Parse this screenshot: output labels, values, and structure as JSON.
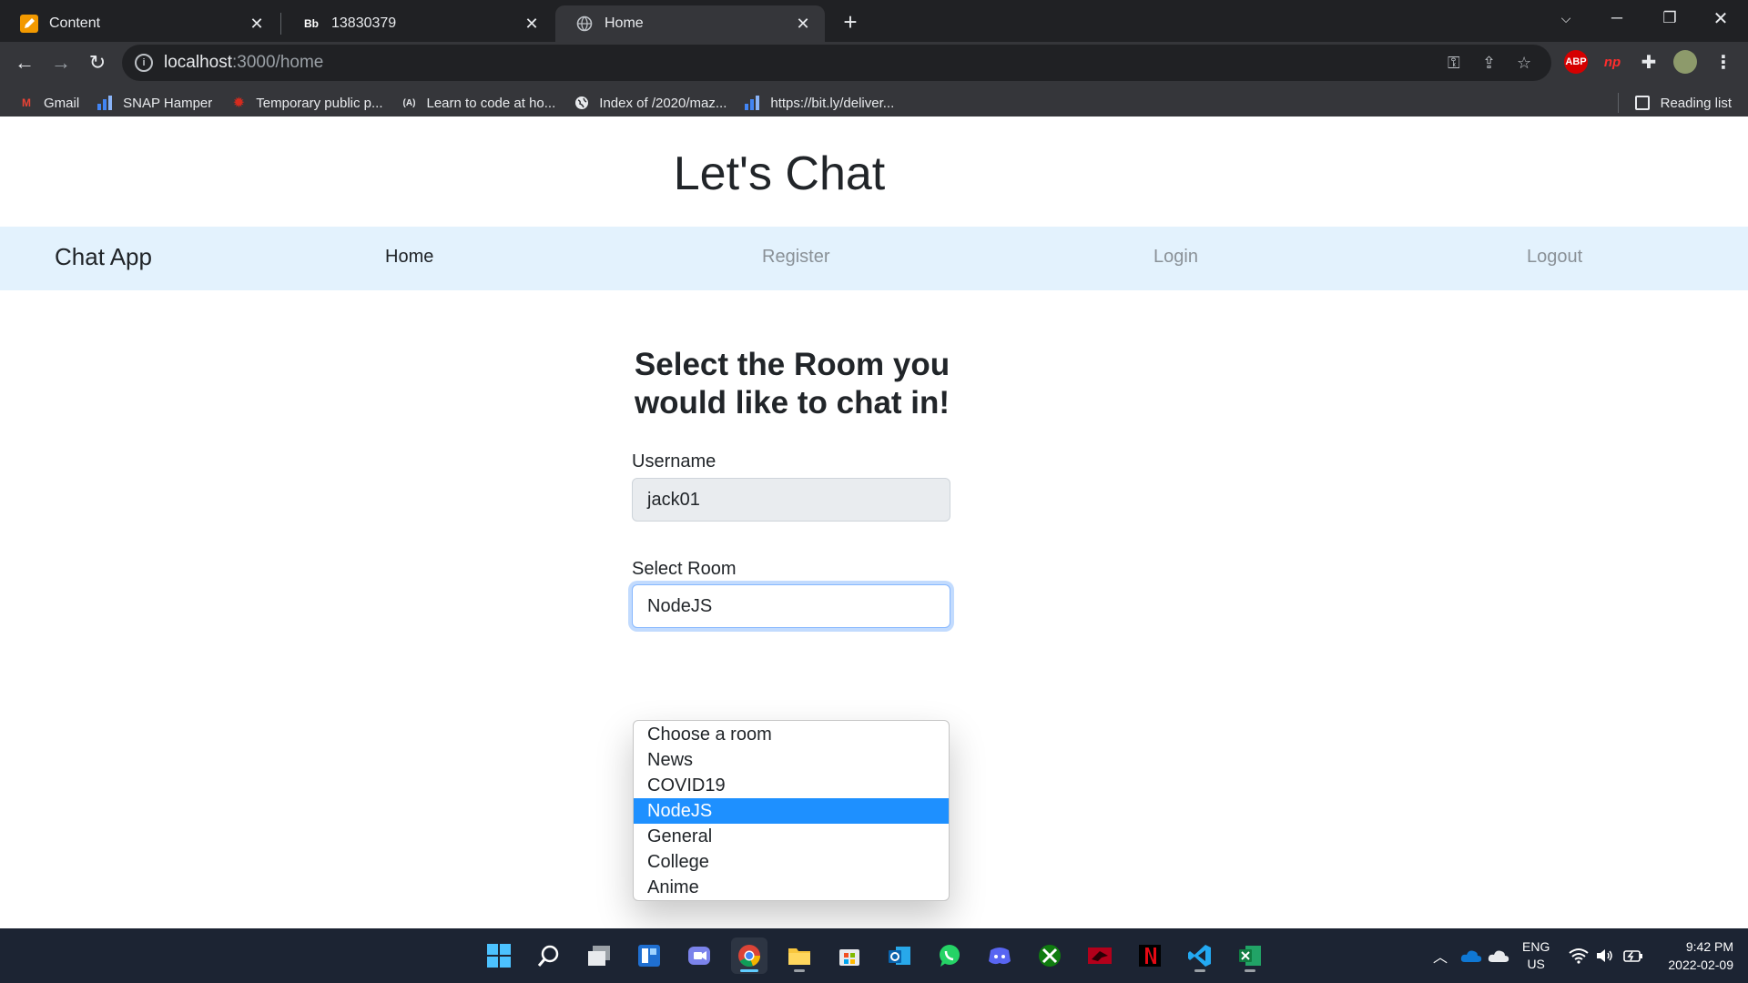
{
  "browser": {
    "tabs": [
      {
        "label": "Content",
        "favicon": "pencil-icon"
      },
      {
        "label": "13830379",
        "favicon_text": "Bb"
      },
      {
        "label": "Home",
        "favicon": "globe-icon"
      }
    ],
    "url_host": "localhost",
    "url_path": ":3000/home",
    "bookmarks": [
      {
        "label": "Gmail",
        "icon": "gmail-icon",
        "icon_text": "M"
      },
      {
        "label": "SNAP Hamper",
        "icon": "chart-icon"
      },
      {
        "label": "Temporary public p...",
        "icon": "maple-leaf-icon"
      },
      {
        "label": "Learn to code at ho...",
        "icon": "code-icon",
        "icon_text": "(A)"
      },
      {
        "label": "Index of /2020/maz...",
        "icon": "globe-icon"
      },
      {
        "label": "https://bit.ly/deliver...",
        "icon": "chart-icon"
      }
    ],
    "reading_list": "Reading list",
    "extensions": {
      "abp": "ABP",
      "np": "np"
    }
  },
  "page": {
    "title": "Let's Chat",
    "navbar": {
      "brand": "Chat App",
      "links": [
        "Home",
        "Register",
        "Login",
        "Logout"
      ]
    },
    "form": {
      "heading": "Select the Room you would like to chat in!",
      "username_label": "Username",
      "username_value": "jack01",
      "room_label": "Select Room",
      "room_value": "NodeJS",
      "room_options": [
        "Choose a room",
        "News",
        "COVID19",
        "NodeJS",
        "General",
        "College",
        "Anime"
      ],
      "selected_index": 3
    }
  },
  "taskbar": {
    "lang": "ENG",
    "region": "US",
    "time": "9:42 PM",
    "date": "2022-02-09"
  },
  "colors": {
    "navbar_bg": "#e3f2fd",
    "selected_option": "#1e90ff",
    "chrome_dark": "#202124",
    "taskbar_bg": "#1c2433"
  }
}
